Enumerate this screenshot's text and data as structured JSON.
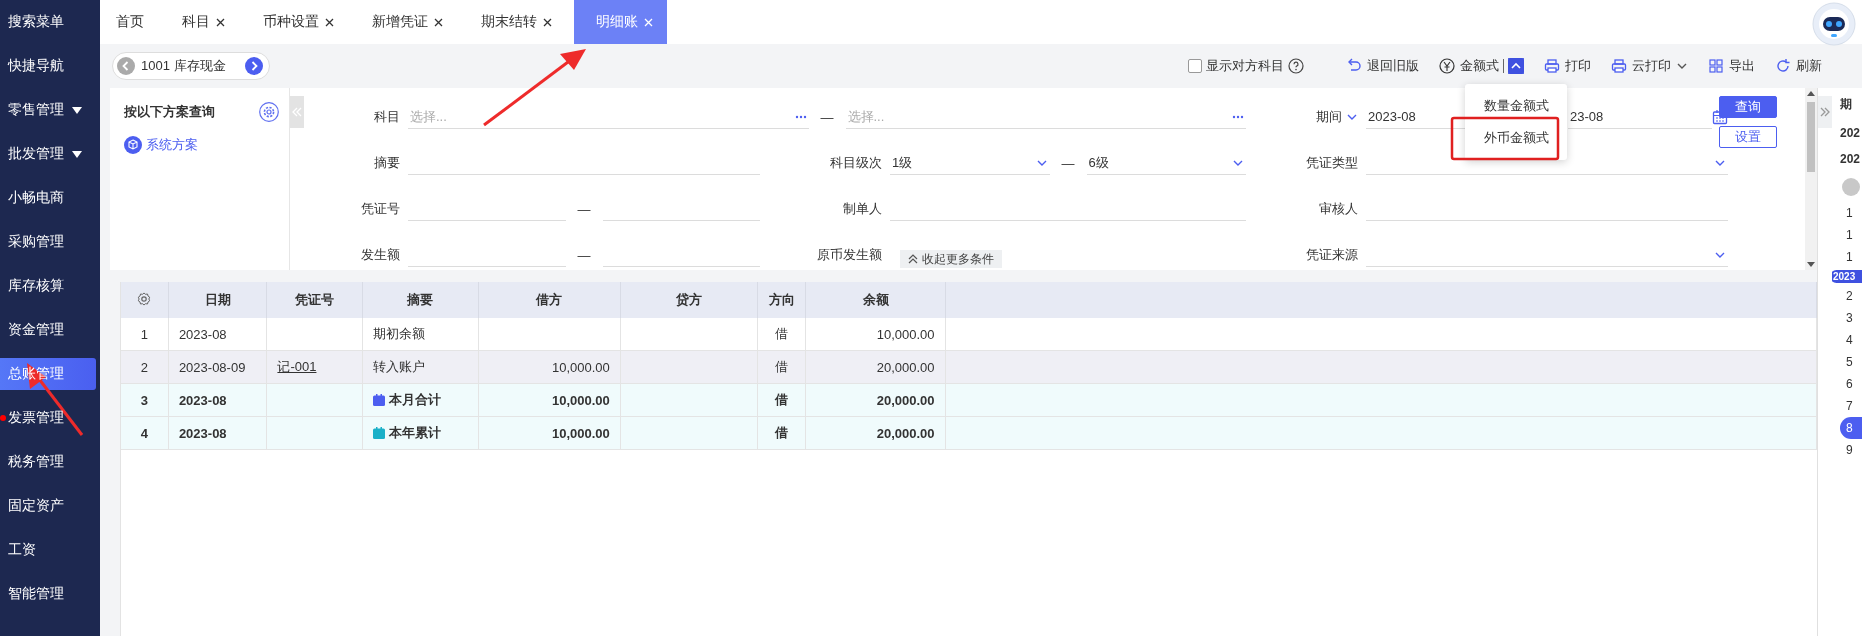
{
  "sidebar": {
    "items": [
      {
        "label": "搜索菜单",
        "expandable": false,
        "selected": false,
        "alert": false
      },
      {
        "label": "快捷导航",
        "expandable": false,
        "selected": false,
        "alert": false
      },
      {
        "label": "零售管理",
        "expandable": true,
        "selected": false,
        "alert": false
      },
      {
        "label": "批发管理",
        "expandable": true,
        "selected": false,
        "alert": false
      },
      {
        "label": "小畅电商",
        "expandable": false,
        "selected": false,
        "alert": false
      },
      {
        "label": "采购管理",
        "expandable": false,
        "selected": false,
        "alert": false
      },
      {
        "label": "库存核算",
        "expandable": false,
        "selected": false,
        "alert": false
      },
      {
        "label": "资金管理",
        "expandable": false,
        "selected": false,
        "alert": false
      },
      {
        "label": "总账管理",
        "expandable": false,
        "selected": true,
        "alert": false
      },
      {
        "label": "发票管理",
        "expandable": false,
        "selected": false,
        "alert": true
      },
      {
        "label": "税务管理",
        "expandable": false,
        "selected": false,
        "alert": false
      },
      {
        "label": "固定资产",
        "expandable": false,
        "selected": false,
        "alert": false
      },
      {
        "label": "工资",
        "expandable": false,
        "selected": false,
        "alert": false
      },
      {
        "label": "智能管理",
        "expandable": false,
        "selected": false,
        "alert": false
      }
    ]
  },
  "tabs": [
    {
      "label": "首页",
      "closable": false,
      "selected": false
    },
    {
      "label": "科目",
      "closable": true,
      "selected": false
    },
    {
      "label": "币种设置",
      "closable": true,
      "selected": false
    },
    {
      "label": "新增凭证",
      "closable": true,
      "selected": false
    },
    {
      "label": "期末结转",
      "closable": true,
      "selected": false
    },
    {
      "label": "明细账",
      "closable": true,
      "selected": true
    }
  ],
  "toolbar": {
    "account": "1001 库存现金",
    "show_counter_account": {
      "label": "显示对方科目",
      "checked": false
    },
    "actions": [
      {
        "kind": "revert",
        "label": "退回旧版"
      },
      {
        "kind": "format",
        "label": "金额式",
        "expanded": true
      },
      {
        "kind": "print",
        "label": "打印"
      },
      {
        "kind": "cloud_print",
        "label": "云打印"
      },
      {
        "kind": "export",
        "label": "导出"
      },
      {
        "kind": "refresh",
        "label": "刷新"
      }
    ]
  },
  "format_menu": {
    "items": [
      {
        "label": "数量金额式"
      },
      {
        "label": "外币金额式"
      }
    ]
  },
  "scheme_panel": {
    "title": "按以下方案查询",
    "schemes": [
      {
        "label": "系统方案"
      }
    ]
  },
  "filters": [
    {
      "label": "科目",
      "kind": "range_picker",
      "placeholders": [
        "选择...",
        "选择..."
      ],
      "separator": "—"
    },
    {
      "label": "期间",
      "kind": "period",
      "values": [
        "2023-08",
        "23-08"
      ]
    },
    {
      "label": "摘要",
      "kind": "text"
    },
    {
      "label": "科目级次",
      "kind": "range_select",
      "values": [
        "1级",
        "6级"
      ],
      "separator": "—"
    },
    {
      "label": "凭证类型",
      "kind": "select"
    },
    {
      "label": "凭证号",
      "kind": "range_text",
      "separator": "—"
    },
    {
      "label": "制单人",
      "kind": "text"
    },
    {
      "label": "审核人",
      "kind": "text"
    },
    {
      "label": "发生额",
      "kind": "range_text",
      "separator": "—"
    },
    {
      "label": "原币发生额",
      "kind": "label_only"
    },
    {
      "label": "凭证来源",
      "kind": "select"
    }
  ],
  "filter_buttons": [
    {
      "label": "查询",
      "kind": "primary"
    },
    {
      "label": "设置",
      "kind": "secondary"
    }
  ],
  "collapse_button": "收起更多条件",
  "table": {
    "columns": [
      "日期",
      "凭证号",
      "摘要",
      "借方",
      "贷方",
      "方向",
      "余额"
    ],
    "rows": [
      {
        "no": "1",
        "date": "2023-08",
        "summary": "期初余额",
        "direction": "借",
        "balance": "10,000.00",
        "kind": "opening",
        "selected": false
      },
      {
        "no": "2",
        "date": "2023-08-09",
        "voucher": "记-001",
        "summary": "转入账户",
        "debit": "10,000.00",
        "direction": "借",
        "balance": "20,000.00",
        "kind": "entry",
        "selected": true
      },
      {
        "no": "3",
        "date": "2023-08",
        "summary": "本月合计",
        "debit": "10,000.00",
        "direction": "借",
        "balance": "20,000.00",
        "kind": "month_total",
        "selected": false
      },
      {
        "no": "4",
        "date": "2023-08",
        "summary": "本年累计",
        "debit": "10,000.00",
        "direction": "借",
        "balance": "20,000.00",
        "kind": "year_total",
        "selected": false
      }
    ]
  },
  "side_panel": {
    "title": "期",
    "years": [
      "202",
      "202"
    ],
    "year_badge": "2023",
    "months": [
      {
        "label": "1",
        "selected": false
      },
      {
        "label": "1",
        "selected": false
      },
      {
        "label": "1",
        "selected": false
      },
      {
        "label": "2",
        "selected": false
      },
      {
        "label": "3",
        "selected": false
      },
      {
        "label": "4",
        "selected": false
      },
      {
        "label": "5",
        "selected": false
      },
      {
        "label": "6",
        "selected": false
      },
      {
        "label": "7",
        "selected": false
      },
      {
        "label": "8",
        "selected": true
      },
      {
        "label": "9",
        "selected": false
      }
    ]
  }
}
